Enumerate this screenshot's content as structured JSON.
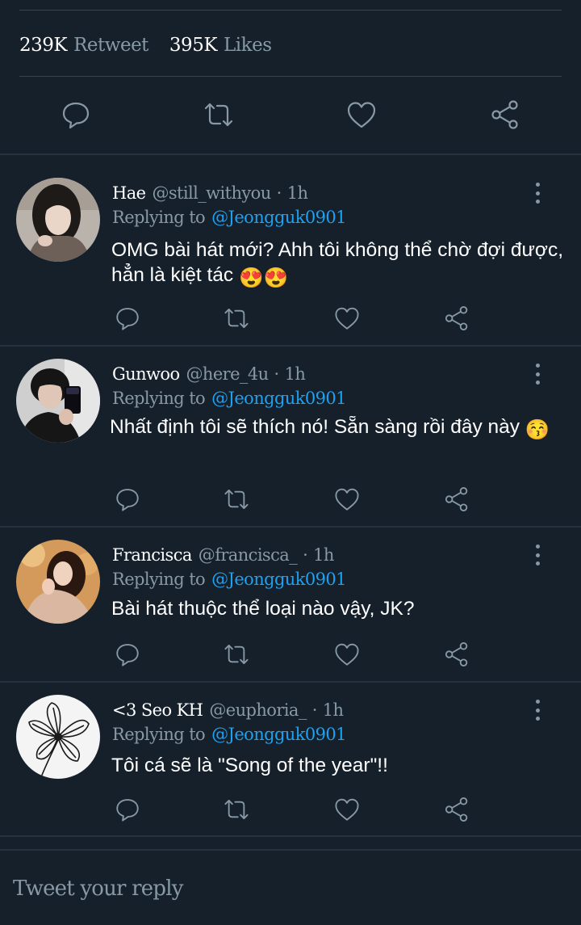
{
  "stats": {
    "retweets_count": "239K",
    "retweets_label": "Retweet",
    "likes_count": "395K",
    "likes_label": "Likes"
  },
  "action_icons": [
    "reply-icon",
    "retweet-icon",
    "like-icon",
    "share-icon"
  ],
  "colors": {
    "background": "#15202b",
    "muted": "#8899a6",
    "link": "#1da1f2",
    "divider": "#38444d"
  },
  "replies": [
    {
      "name": "Hae",
      "handle": "@still_withyou",
      "time": "1h",
      "replying_label": "Replying to",
      "replying_to": "@Jeongguk0901",
      "text": "OMG bài hát mới? Ahh tôi không thể chờ đợi được, hẳn là kiệt tác",
      "emoji": "😍😍"
    },
    {
      "name": "Gunwoo",
      "handle": "@here_4u",
      "time": "1h",
      "replying_label": "Replying to",
      "replying_to": "@Jeongguk0901",
      "text": "Nhất định tôi sẽ thích nó! Sẵn sàng rồi đây này",
      "emoji": "😚"
    },
    {
      "name": "Francisca",
      "handle": "@francisca_",
      "time": "1h",
      "replying_label": "Replying to",
      "replying_to": "@Jeongguk0901",
      "text": "Bài hát thuộc thể loại nào vậy, JK?"
    },
    {
      "name": "<3 Seo KH",
      "handle": "@euphoria_",
      "time": "1h",
      "replying_label": "Replying to",
      "replying_to": "@Jeongguk0901",
      "text": "Tôi cá sẽ là \"Song of the year\"!!"
    }
  ],
  "reply_box": {
    "placeholder": "Tweet your reply"
  }
}
